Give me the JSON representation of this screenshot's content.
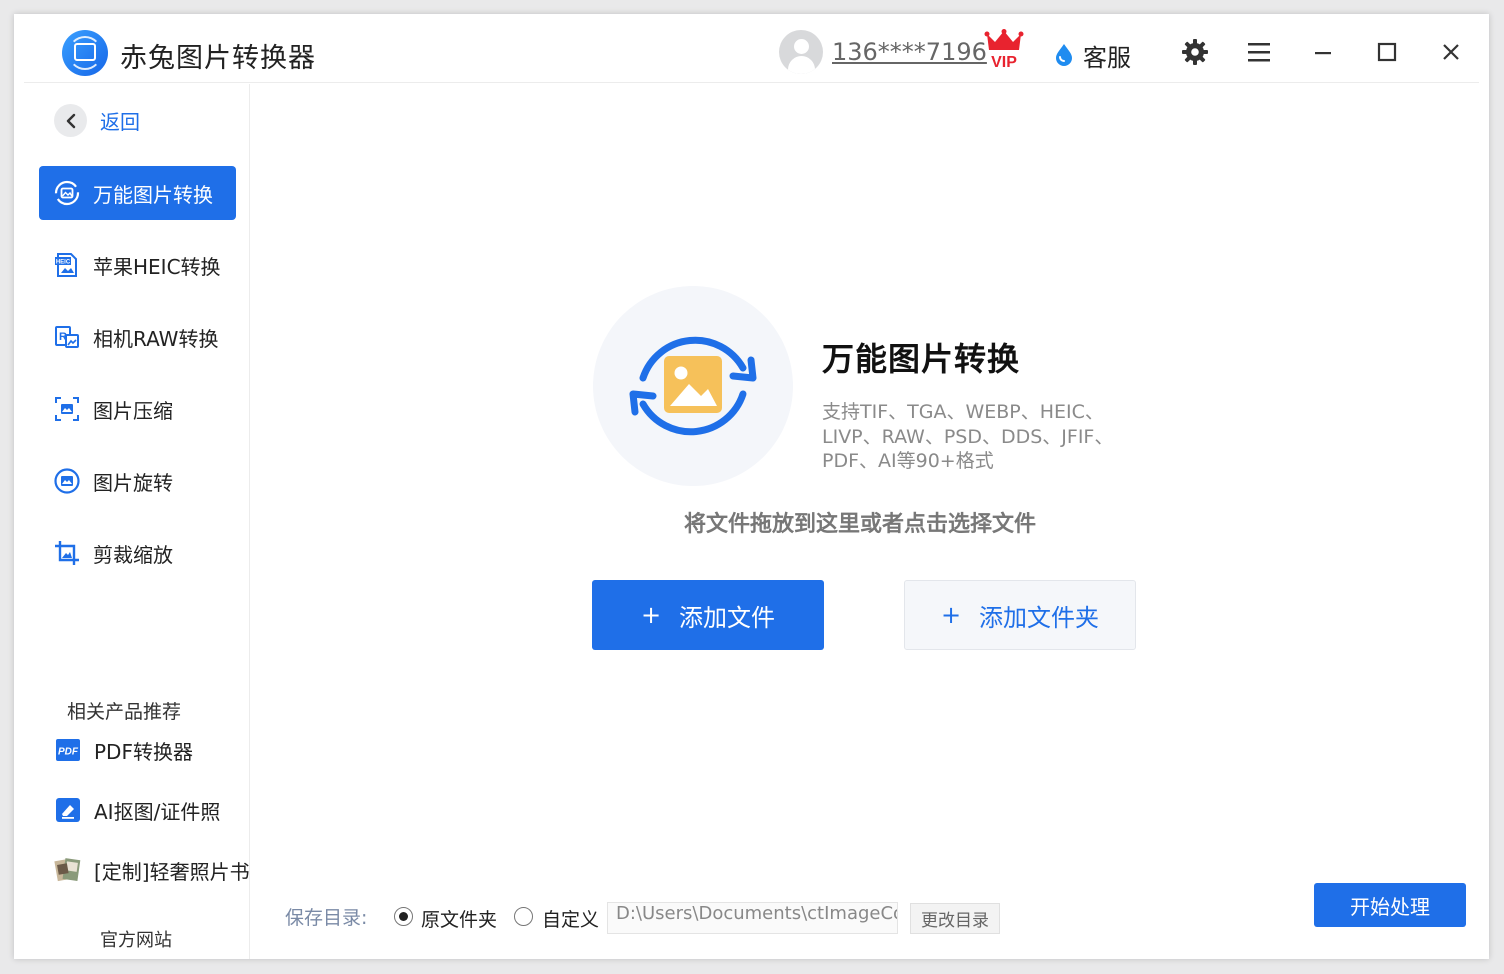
{
  "app": {
    "title": "赤兔图片转换器"
  },
  "header": {
    "user_phone": "136****7196",
    "vip_label": "VIP",
    "support_label": "客服"
  },
  "sidebar": {
    "back_label": "返回",
    "items": [
      {
        "label": "万能图片转换",
        "icon": "image-convert-icon",
        "active": true
      },
      {
        "label": "苹果HEIC转换",
        "icon": "heic-file-icon",
        "active": false
      },
      {
        "label": "相机RAW转换",
        "icon": "raw-file-icon",
        "active": false
      },
      {
        "label": "图片压缩",
        "icon": "compress-icon",
        "active": false
      },
      {
        "label": "图片旋转",
        "icon": "rotate-icon",
        "active": false
      },
      {
        "label": "剪裁缩放",
        "icon": "crop-icon",
        "active": false
      }
    ],
    "related_heading": "相关产品推荐",
    "related": [
      {
        "label": "PDF转换器",
        "icon": "pdf-icon",
        "icon_text": "PDF"
      },
      {
        "label": "AI抠图/证件照",
        "icon": "eraser-icon"
      },
      {
        "label": "[定制]轻奢照片书",
        "icon": "photo-book-icon"
      }
    ],
    "official_site": "官方网站"
  },
  "main": {
    "title": "万能图片转换",
    "description": "支持TIF、TGA、WEBP、HEIC、LIVP、RAW、PSD、DDS、JFIF、PDF、AI等90+格式",
    "drop_hint": "将文件拖放到这里或者点击选择文件",
    "add_file_label": "添加文件",
    "add_folder_label": "添加文件夹",
    "plus": "+"
  },
  "footer": {
    "save_dir_label": "保存目录:",
    "option_original": "原文件夹",
    "option_custom": "自定义",
    "selected_option": "原文件夹",
    "path_value": "D:\\Users\\Documents\\ctImageConverter",
    "change_dir_label": "更改目录",
    "start_label": "开始处理"
  },
  "colors": {
    "accent": "#1f6fe8",
    "image_yellow": "#f6c15a"
  }
}
